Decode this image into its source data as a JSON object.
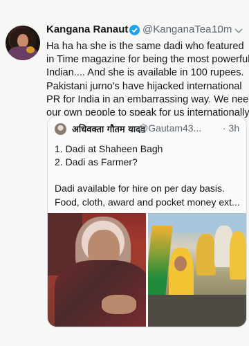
{
  "tweet": {
    "author_name": "Kangana Ranaut",
    "author_handle": "@KanganaTea...",
    "time": "· 10m",
    "text_lines": [
      "Ha ha ha she is the same dadi who featured",
      "in Time magazine for being the most powerful",
      "Indian.... And she is available in 100 rupees.",
      "Pakistani jurno's have hijacked international",
      "PR for India in an embarrassing way. We need",
      "our own people to speak for us internationally."
    ]
  },
  "quoted_tweet": {
    "author_name": "अधिवक्ता गौतम यादव",
    "author_handle": "@Gautam43...",
    "time": "· 3h",
    "lines": [
      "1. Dadi at Shaheen Bagh",
      "2. Dadi as Farmer?",
      "",
      "Dadi available for hire on per day basis.",
      "Food, cloth, award and pocket money ext..."
    ]
  },
  "icons": {
    "verified": "verified-badge-icon",
    "more": "chevron-down-icon"
  },
  "colors": {
    "background": "#f7f7f5",
    "text": "#14171a",
    "secondary_text": "#5b6672",
    "verified_blue": "#1da1f2",
    "quote_border": "#d5dbe0"
  }
}
